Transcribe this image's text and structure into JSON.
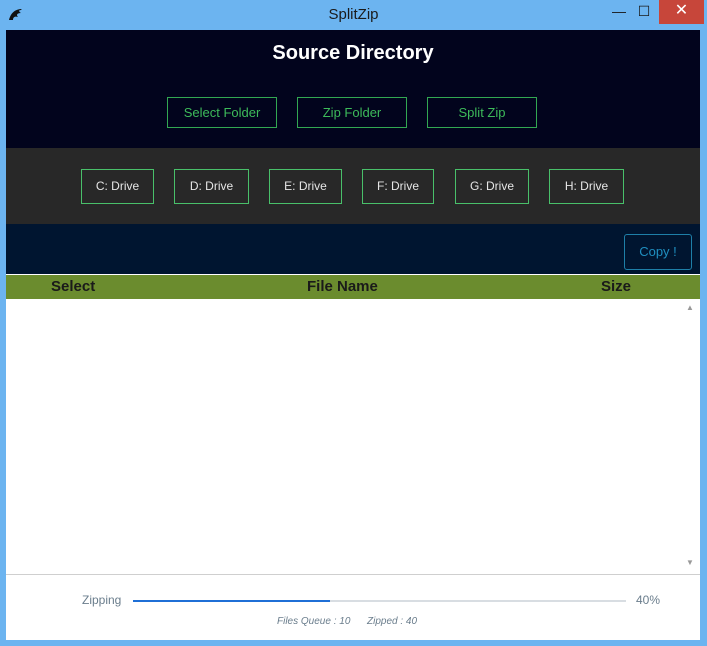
{
  "window": {
    "title": "SplitZip",
    "minimize_glyph": "—",
    "maximize_glyph": "☐",
    "close_glyph": "✕",
    "app_icon": "dragon-icon"
  },
  "source": {
    "heading": "Source Directory",
    "buttons": {
      "select_folder": "Select Folder",
      "zip_folder": "Zip Folder",
      "split_zip": "Split Zip"
    }
  },
  "drives": [
    "C: Drive",
    "D: Drive",
    "E: Drive",
    "F: Drive",
    "G: Drive",
    "H: Drive"
  ],
  "copy_button": "Copy !",
  "table": {
    "columns": [
      "Select",
      "File Name",
      "Size"
    ],
    "rows": []
  },
  "progress": {
    "label": "Zipping",
    "percent_text": "40%",
    "value": 0.4
  },
  "stats": {
    "files_queue": "Files Queue : 10",
    "zipped": "Zipped : 40"
  },
  "colors": {
    "header_bg": "#02041d",
    "drive_bg": "#282828",
    "copy_bg": "#001530",
    "table_header_bg": "#6b8c2e",
    "accent_green": "#3dbb5a",
    "progress_fill": "#1f6fd6"
  }
}
